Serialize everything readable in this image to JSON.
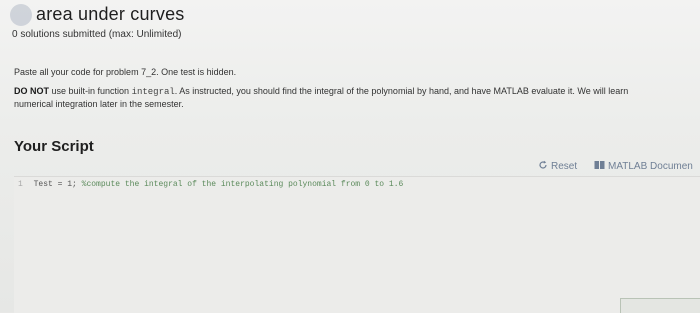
{
  "header": {
    "title": "area under curves",
    "submissions": "0 solutions submitted (max: Unlimited)"
  },
  "instructions": {
    "line1": "Paste all your code for problem 7_2. One test is hidden.",
    "do_not": "DO NOT",
    "line2_a": "use built-in function",
    "line2_code": "integral",
    "line2_b": ". As instructed, you should find the integral of the polynomial by hand, and have MATLAB evaluate it. We will learn",
    "line3": "numerical integration later in the semester."
  },
  "script": {
    "heading": "Your Script",
    "reset_label": "Reset",
    "docs_label": "MATLAB Documen",
    "code": {
      "line_number": "1",
      "statement": "Test = 1;",
      "comment": "%compute the integral of the interpolating polynomial from 0 to 1.6"
    }
  },
  "icons": {
    "reset": "reset-icon",
    "docs": "book-icon"
  }
}
